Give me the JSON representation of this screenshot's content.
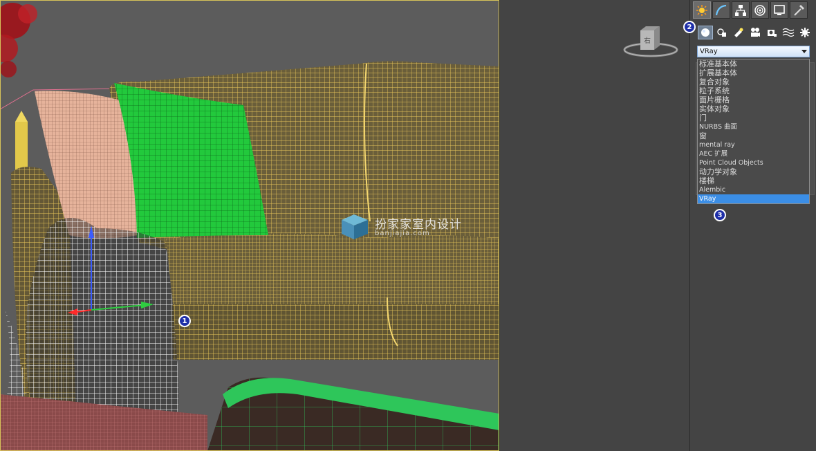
{
  "command_panel": {
    "tabs": [
      {
        "name": "create",
        "icon": "create-sun-icon",
        "active": true
      },
      {
        "name": "modify",
        "icon": "modify-arc-icon",
        "active": false
      },
      {
        "name": "hierarchy",
        "icon": "hierarchy-icon",
        "active": false
      },
      {
        "name": "motion",
        "icon": "motion-icon",
        "active": false
      },
      {
        "name": "display",
        "icon": "display-icon",
        "active": false
      },
      {
        "name": "utilities",
        "icon": "utilities-hammer-icon",
        "active": false
      }
    ],
    "categories": [
      {
        "name": "geometry",
        "icon": "geometry-sphere-icon",
        "active": true
      },
      {
        "name": "shapes",
        "icon": "shapes-icon",
        "active": false
      },
      {
        "name": "lights",
        "icon": "lights-icon",
        "active": false
      },
      {
        "name": "cameras",
        "icon": "cameras-icon",
        "active": false
      },
      {
        "name": "helpers",
        "icon": "helpers-icon",
        "active": false
      },
      {
        "name": "space-warps",
        "icon": "space-warps-icon",
        "active": false
      },
      {
        "name": "systems",
        "icon": "systems-gear-icon",
        "active": false
      }
    ],
    "dropdown": {
      "selected": "VRay",
      "options": [
        "标准基本体",
        "扩展基本体",
        "复合对象",
        "粒子系统",
        "面片栅格",
        "实体对象",
        "门",
        "NURBS 曲面",
        "窗",
        "mental ray",
        "AEC 扩展",
        "Point Cloud Objects",
        "动力学对象",
        "楼梯",
        "Alembic",
        "VRay"
      ]
    }
  },
  "markers": {
    "one": "1",
    "two": "2",
    "three": "3"
  },
  "watermark": {
    "text": "扮家家室内设计",
    "url": "banjiajia.com"
  },
  "viewcube": {
    "face_label": "右"
  },
  "colors": {
    "wire_yellow": "#e8c65a",
    "wire_green": "#22c93c",
    "wire_pink": "#e6b39b",
    "wire_white": "#ffffff",
    "selection_blue": "#3b8ee6",
    "marker_blue": "#1f2fa8"
  }
}
